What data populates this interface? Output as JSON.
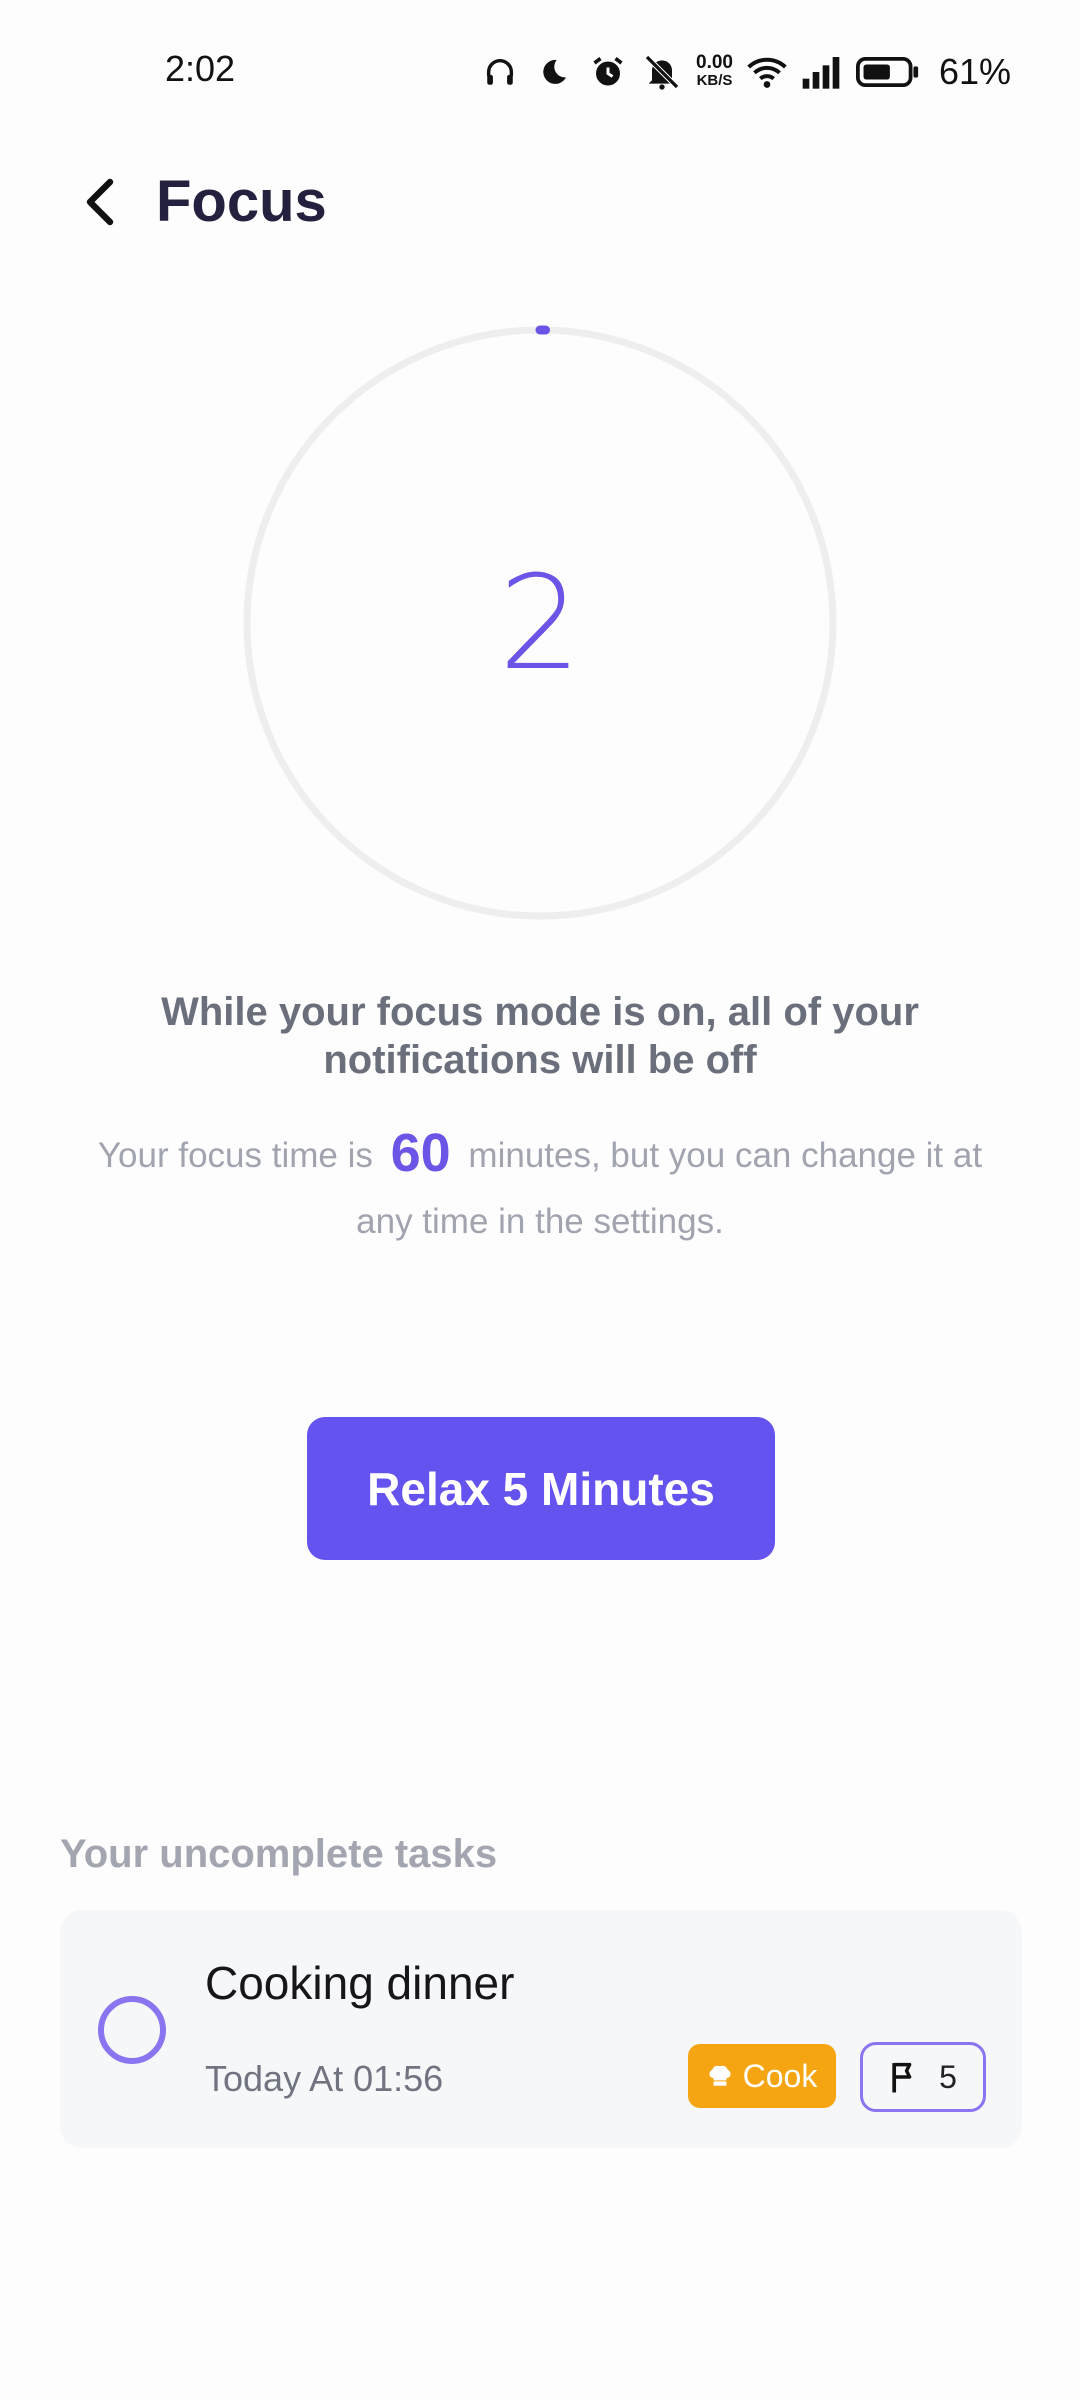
{
  "status_bar": {
    "time": "2:02",
    "net_speed_value": "0.00",
    "net_speed_unit": "KB/S",
    "battery_percent": "61%",
    "icons": [
      "headphones-icon",
      "moon-icon",
      "alarm-icon",
      "mute-icon",
      "wifi-icon",
      "signal-icon",
      "battery-icon"
    ]
  },
  "header": {
    "title": "Focus",
    "back_icon": "chevron-left-icon"
  },
  "timer": {
    "value": "2",
    "progress_fraction": 0.003,
    "accent_color": "#6a55e6",
    "track_color": "#eeeeee"
  },
  "message": {
    "title": "While your focus mode is on, all of your notifications will be off",
    "body_prefix": "Your focus time is",
    "focus_minutes": "60",
    "body_suffix": "minutes, but you can change it at any time in the settings."
  },
  "relax_button": {
    "label": "Relax 5 Minutes",
    "color": "#6553ef"
  },
  "tasks": {
    "heading": "Your uncomplete tasks",
    "items": [
      {
        "title": "Cooking dinner",
        "time": "Today At 01:56",
        "category_label": "Cook",
        "category_icon": "chef-hat-icon",
        "category_color": "#f6a512",
        "priority_icon": "flag-icon",
        "priority_value": "5"
      }
    ]
  }
}
